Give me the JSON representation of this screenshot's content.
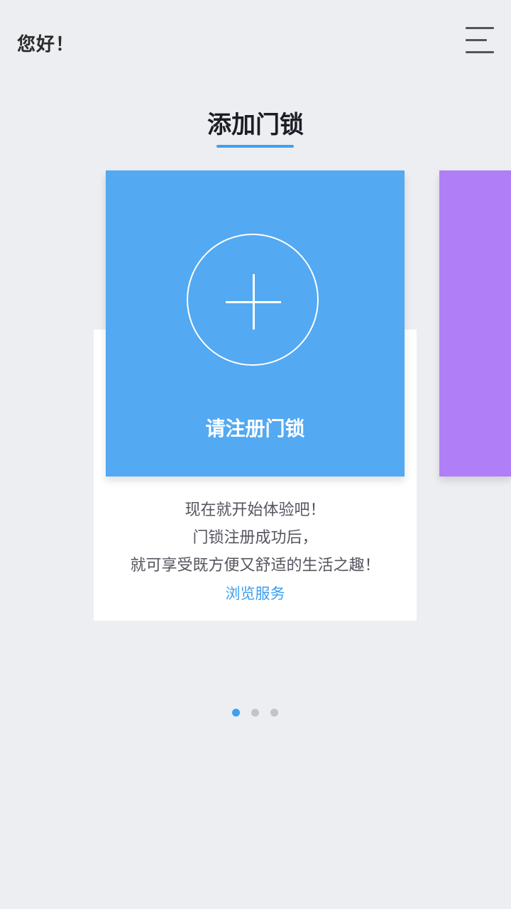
{
  "header": {
    "greeting": "您好！",
    "menu_icon": "hamburger-menu-icon"
  },
  "page": {
    "title": "添加门锁",
    "accent_color": "#3fa0ee"
  },
  "carousel": {
    "cards": [
      {
        "icon": "plus-circle-icon",
        "label": "请注册门锁",
        "color": "#53a9f2"
      },
      {
        "label": "",
        "color": "#b07ef7"
      }
    ],
    "description": [
      "现在就开始体验吧！",
      "门锁注册成功后，",
      "就可享受既方便又舒适的生活之趣！"
    ],
    "link_label": "浏览服务",
    "page_count": 3,
    "active_page": 1
  }
}
